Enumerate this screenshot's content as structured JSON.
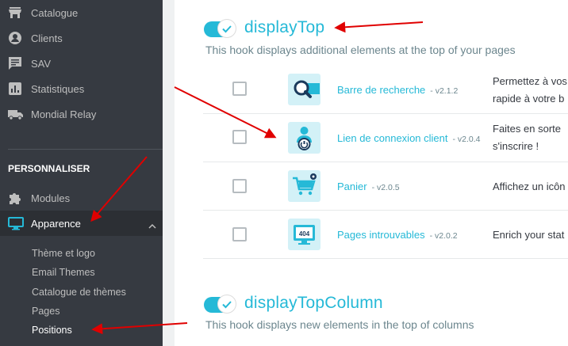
{
  "sidebar": {
    "items": [
      {
        "label": "Catalogue",
        "icon": "store-icon"
      },
      {
        "label": "Clients",
        "icon": "account-circle-icon"
      },
      {
        "label": "SAV",
        "icon": "chat-icon"
      },
      {
        "label": "Statistiques",
        "icon": "bar-chart-icon"
      },
      {
        "label": "Mondial Relay",
        "icon": "truck-icon"
      }
    ],
    "section_title": "PERSONNALISER",
    "custom_items": [
      {
        "label": "Modules",
        "icon": "puzzle-icon"
      },
      {
        "label": "Apparence",
        "icon": "monitor-icon",
        "active": true
      }
    ],
    "submenu": [
      {
        "label": "Thème et logo"
      },
      {
        "label": "Email Themes"
      },
      {
        "label": "Catalogue de thèmes"
      },
      {
        "label": "Pages"
      },
      {
        "label": "Positions",
        "active": true
      }
    ]
  },
  "hooks": [
    {
      "title": "displayTop",
      "description": "This hook displays additional elements at the top of your pages",
      "enabled": true,
      "modules": [
        {
          "name": "Barre de recherche",
          "version": "- v2.1.2",
          "description_lines": [
            "Permettez à vos",
            "rapide à votre b"
          ],
          "icon": "search-module-icon"
        },
        {
          "name": "Lien de connexion client",
          "version": "- v2.0.4",
          "description_lines": [
            "Faites en sorte",
            "s'inscrire !"
          ],
          "icon": "customer-login-icon"
        },
        {
          "name": "Panier",
          "version": "- v2.0.5",
          "description_lines": [
            "Affichez un icôn"
          ],
          "icon": "cart-icon"
        },
        {
          "name": "Pages introuvables",
          "version": "- v2.0.2",
          "description_lines": [
            "Enrich your stat"
          ],
          "icon": "404-icon"
        }
      ]
    },
    {
      "title": "displayTopColumn",
      "description": "This hook displays new elements in the top of columns",
      "enabled": true
    }
  ],
  "colors": {
    "accent": "#25b9d7",
    "sidebar_bg": "#363a41",
    "annotation": "#e00000"
  }
}
